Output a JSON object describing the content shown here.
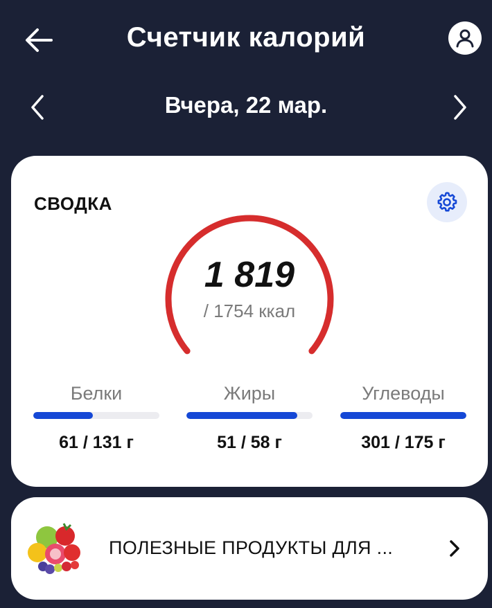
{
  "header": {
    "title": "Счетчик калорий",
    "back_icon": "arrow-left-icon",
    "profile_icon": "user-icon"
  },
  "date_nav": {
    "label": "Вчера, 22 мар.",
    "prev_icon": "chevron-left-icon",
    "next_icon": "chevron-right-icon"
  },
  "summary": {
    "title": "СВОДКА",
    "settings_icon": "gear-icon",
    "calories": {
      "value": "1 819",
      "target": "/ 1754 ккал",
      "fraction": 1.0
    },
    "macros": [
      {
        "label": "Белки",
        "amount": "61 / 131 г",
        "fraction": 0.47
      },
      {
        "label": "Жиры",
        "amount": "51 / 58 г",
        "fraction": 0.88
      },
      {
        "label": "Углеводы",
        "amount": "301 / 175 г",
        "fraction": 1.0
      }
    ]
  },
  "promo": {
    "text": "ПОЛЕЗНЫЕ ПРОДУКТЫ ДЛЯ ...",
    "image": "fruits-image",
    "chevron_icon": "chevron-right-icon"
  },
  "colors": {
    "background": "#1b2136",
    "accent_red": "#d62d2d",
    "accent_blue": "#1548d6",
    "card": "#ffffff"
  }
}
